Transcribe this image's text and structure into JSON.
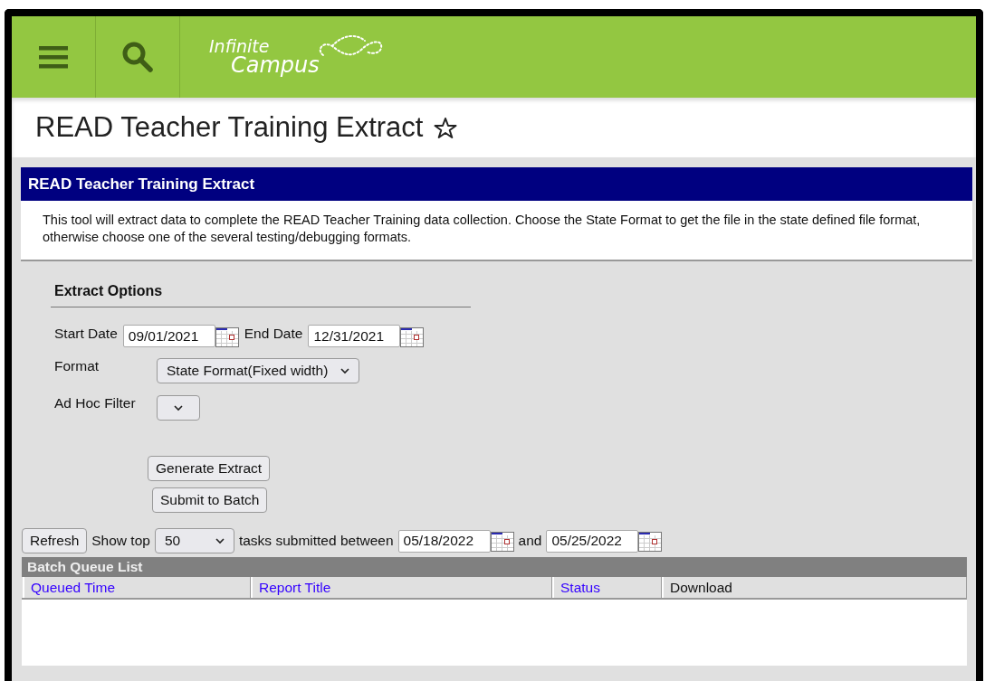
{
  "header": {
    "logo_text": [
      "Infinite",
      "Campus"
    ]
  },
  "page_title": {
    "text": "READ Teacher Training Extract",
    "starred": false
  },
  "panel": {
    "title": "READ Teacher Training Extract",
    "description": "This tool will extract data to complete the READ Teacher Training data collection. Choose the State Format to get the file in the state defined file format, otherwise choose one of the several testing/debugging formats."
  },
  "extract_options": {
    "heading": "Extract Options",
    "start_date": {
      "label": "Start Date",
      "value": "09/01/2021"
    },
    "end_date": {
      "label": "End Date",
      "value": "12/31/2021"
    },
    "format": {
      "label": "Format",
      "value": "State Format(Fixed width)"
    },
    "ad_hoc_filter": {
      "label": "Ad Hoc Filter"
    },
    "buttons": [
      "Generate Extract",
      "Submit to Batch"
    ]
  },
  "batch": {
    "refresh": "Refresh",
    "show_top_label": "Show top",
    "show_top_value": "50",
    "between_label": "tasks submitted between",
    "from_date": "05/18/2022",
    "and_label": "and",
    "to_date": "05/25/2022",
    "list_title": "Batch Queue List",
    "columns": [
      {
        "label": "Queued Time",
        "sortable": true
      },
      {
        "label": "Report Title",
        "sortable": true
      },
      {
        "label": "Status",
        "sortable": true
      },
      {
        "label": "Download",
        "sortable": false
      }
    ]
  }
}
